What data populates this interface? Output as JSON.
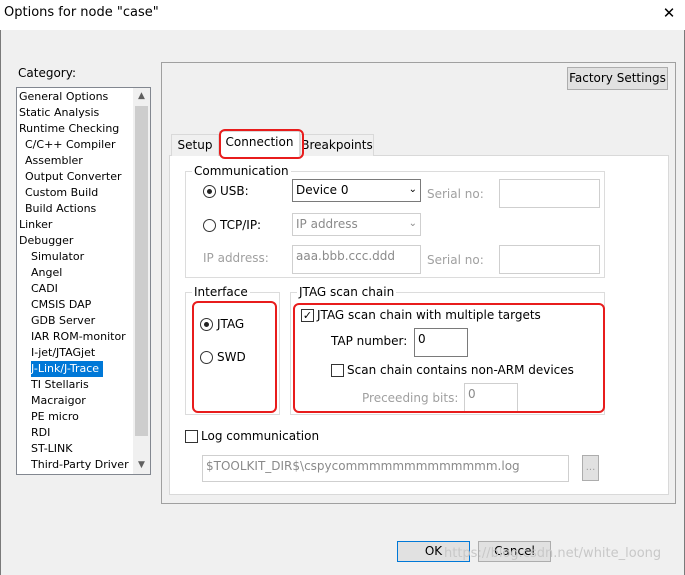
{
  "window": {
    "title": "Options for node \"case\"",
    "close_glyph": "✕"
  },
  "category": {
    "label": "Category:",
    "items": [
      "General Options",
      "Static Analysis",
      "Runtime Checking",
      "C/C++ Compiler",
      "Assembler",
      "Output Converter",
      "Custom Build",
      "Build Actions",
      "Linker",
      "Debugger",
      "Simulator",
      "Angel",
      "CADI",
      "CMSIS DAP",
      "GDB Server",
      "IAR ROM-monitor",
      "I-jet/JTAGjet",
      "J-Link/J-Trace",
      "TI Stellaris",
      "Macraigor",
      "PE micro",
      "RDI",
      "ST-LINK",
      "Third-Party Driver"
    ],
    "selected": "J-Link/J-Trace"
  },
  "factory_settings": "Factory Settings",
  "tabs": [
    "Setup",
    "Connection",
    "Breakpoints"
  ],
  "active_tab": "Connection",
  "communication": {
    "title": "Communication",
    "usb_label": "USB:",
    "usb_selected": true,
    "usb_device": "Device 0",
    "tcpip_label": "TCP/IP:",
    "tcpip_selected": false,
    "ip_dropdown": "IP address",
    "serial_no_label": "Serial no:",
    "ip_address_label": "IP address:",
    "ip_address_placeholder": "aaa.bbb.ccc.ddd",
    "serial_no_label2": "Serial no:"
  },
  "interface": {
    "title": "Interface",
    "jtag": "JTAG",
    "swd": "SWD",
    "selected": "JTAG"
  },
  "jtag_chain": {
    "title": "JTAG scan chain",
    "multi_targets": "JTAG scan chain with multiple targets",
    "multi_targets_checked": true,
    "tap_label": "TAP number:",
    "tap_value": "0",
    "non_arm": "Scan chain contains non-ARM devices",
    "non_arm_checked": false,
    "preceding_label": "Preceeding bits:",
    "preceding_value": "0"
  },
  "log": {
    "label": "Log communication",
    "checked": false,
    "path": "$TOOLKIT_DIR$\\cspycommmmmmmmmmmmm.log",
    "browse": "..."
  },
  "buttons": {
    "ok": "OK",
    "cancel": "Cancel"
  },
  "watermark": "https://blog.csdn.net/white_loong",
  "colors": {
    "selection": "#0078d7",
    "highlight_box": "#e81c1c"
  }
}
